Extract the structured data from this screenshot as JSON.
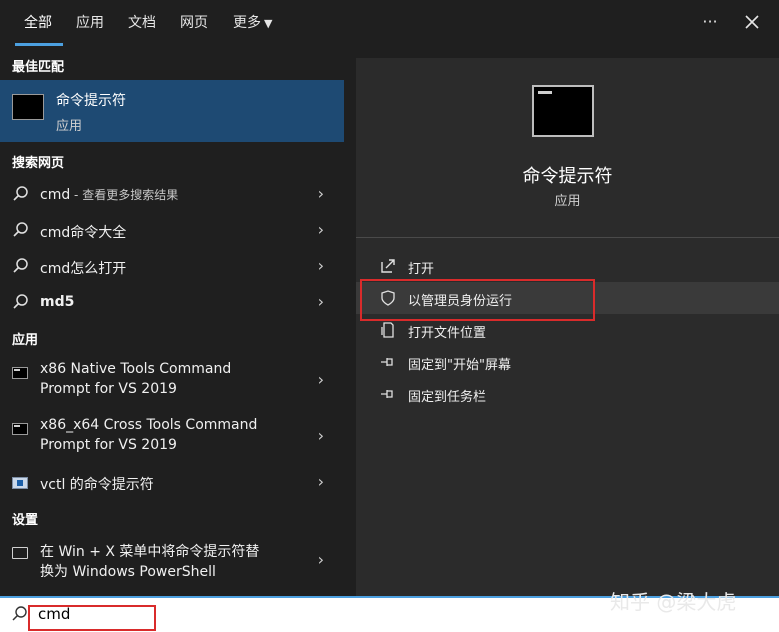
{
  "tabs": [
    {
      "label": "全部"
    },
    {
      "label": "应用"
    },
    {
      "label": "文档"
    },
    {
      "label": "网页"
    },
    {
      "label": "更多"
    }
  ],
  "topbar": {
    "more_icon": "ellipsis-icon",
    "close_icon": "close-icon"
  },
  "left": {
    "best_match_header": "最佳匹配",
    "best_match": {
      "title": "命令提示符",
      "subtitle": "应用"
    },
    "web_header": "搜索网页",
    "web_items": [
      {
        "label": "cmd",
        "suffix": " - 查看更多搜索结果"
      },
      {
        "label": "cmd命令大全"
      },
      {
        "label": "cmd怎么打开"
      },
      {
        "label": "md5"
      }
    ],
    "apps_header": "应用",
    "apps": [
      {
        "line1": "x86 Native Tools Command",
        "line2": "Prompt for VS 2019"
      },
      {
        "line1": "x86_x64 Cross Tools Command",
        "line2": "Prompt for VS 2019"
      },
      {
        "line1": "vctl 的命令提示符"
      }
    ],
    "settings_header": "设置",
    "settings": [
      {
        "line1": "在 Win + X 菜单中将命令提示符替",
        "line2": "换为 Windows PowerShell"
      }
    ]
  },
  "right": {
    "title": "命令提示符",
    "subtitle": "应用",
    "actions": [
      {
        "label": "打开",
        "icon": "open-icon"
      },
      {
        "label": "以管理员身份运行",
        "icon": "shield-icon"
      },
      {
        "label": "打开文件位置",
        "icon": "file-location-icon"
      },
      {
        "label": "固定到\"开始\"屏幕",
        "icon": "pin-icon"
      },
      {
        "label": "固定到任务栏",
        "icon": "pin-icon"
      }
    ]
  },
  "search": {
    "value": "cmd"
  },
  "watermark": "知乎 @梁大虎",
  "colors": {
    "accent": "#4ca0e0",
    "selection": "#1e4a73",
    "highlight_box": "#d92b2b"
  }
}
